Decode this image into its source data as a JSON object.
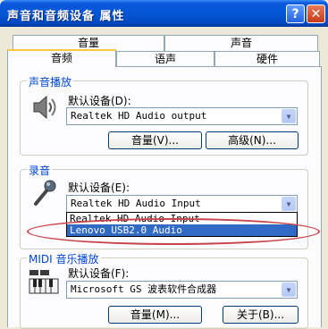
{
  "window": {
    "title": "声音和音频设备 属性",
    "help_label": "?",
    "close_label": "✕"
  },
  "tabs": {
    "row1": [
      "音量",
      "声音"
    ],
    "row2": [
      "音频",
      "语声",
      "硬件"
    ],
    "active": "音频"
  },
  "playback": {
    "group_label": "声音播放",
    "default_label": "默认设备(D):",
    "selected": "Realtek HD Audio output",
    "volume_button": "音量(V)...",
    "advanced_button": "高级(N)...",
    "icon": "speaker-icon"
  },
  "recording": {
    "group_label": "录音",
    "default_label": "默认设备(E):",
    "selected": "Realtek HD Audio Input",
    "options": [
      "Realtek HD Audio Input",
      "Lenovo USB2.0 Audio"
    ],
    "highlighted": "Lenovo USB2.0 Audio",
    "icon": "microphone-icon"
  },
  "midi": {
    "group_label": "MIDI 音乐播放",
    "default_label": "默认设备(F):",
    "selected": "Microsoft GS 波表软件合成器",
    "volume_button": "音量(M)...",
    "about_button": "关于(B)...",
    "icon": "midi-keyboard-icon"
  },
  "colors": {
    "titlebar": "#0556d6",
    "group_label": "#0046d5",
    "selection": "#316ac5",
    "annotation": "#c9434a"
  }
}
